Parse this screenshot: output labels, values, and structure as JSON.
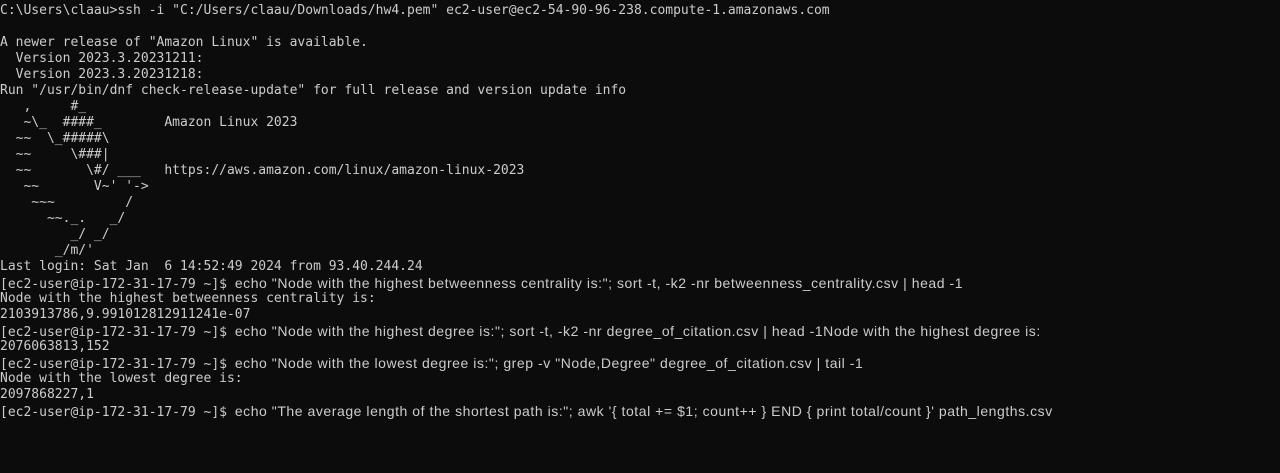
{
  "terminal": {
    "colors": {
      "background": "#0c0c0c",
      "foreground": "#cccccc"
    },
    "ssh_command": "C:\\Users\\claau>ssh -i \"C:/Users/claau/Downloads/hw4.pem\" ec2-user@ec2-54-90-96-238.compute-1.amazonaws.com",
    "notice": "A newer release of \"Amazon Linux\" is available.",
    "version_1": "  Version 2023.3.20231211:",
    "version_2": "  Version 2023.3.20231218:",
    "run_hint": "Run \"/usr/bin/dnf check-release-update\" for full release and version update info",
    "banner": [
      "   ,     #_",
      "   ~\\_  ####_        Amazon Linux 2023",
      "  ~~  \\_#####\\",
      "  ~~     \\###|",
      "  ~~       \\#/ ___   https://aws.amazon.com/linux/amazon-linux-2023",
      "   ~~       V~' '->",
      "    ~~~         /",
      "      ~~._.   _/",
      "         _/ _/",
      "       _/m/'"
    ],
    "last_login": "Last login: Sat Jan  6 14:52:49 2024 from 93.40.244.24",
    "prompt": "[ec2-user@ip-172-31-17-79 ~]$ ",
    "cmd_1": "echo \"Node with the highest betweenness centrality is:\"; sort -t, -k2 -nr betweenness_centrality.csv | head -1",
    "out_1a": "Node with the highest betweenness centrality is:",
    "out_1b": "2103913786,9.991012812911241e-07",
    "cmd_2": "echo \"Node with the highest degree is:\"; sort -t, -k2 -nr degree_of_citation.csv | head -1Node with the highest degree is:",
    "out_2": "2076063813,152",
    "cmd_3": "echo \"Node with the lowest degree is:\"; grep -v \"Node,Degree\" degree_of_citation.csv | tail -1",
    "out_3a": "Node with the lowest degree is:",
    "out_3b": "2097868227,1",
    "cmd_4": "echo \"The average length of the shortest path is:\"; awk '{ total += $1; count++ } END { print total/count }' path_lengths.csv"
  }
}
